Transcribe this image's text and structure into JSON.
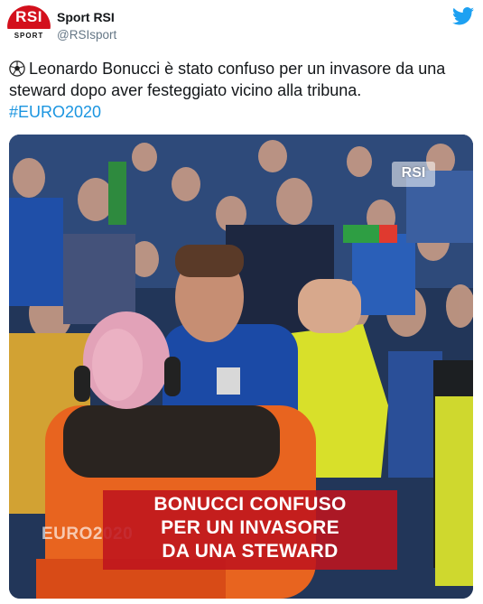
{
  "account": {
    "avatar_text": "RSI",
    "avatar_subtext": "SPORT",
    "name": "Sport RSI",
    "handle": "@RSIsport"
  },
  "tweet": {
    "emoji": "soccer-ball-icon",
    "text": "Leonardo Bonucci è stato confuso per un invasore da una steward dopo aver festeggiato vicino alla tribuna.",
    "hashtag": "#EURO2020"
  },
  "media": {
    "watermark": "RSI",
    "euro_watermark": "EURO2020",
    "caption_lines": [
      "BONUCCI CONFUSO",
      "PER UN INVASORE",
      "DA UNA STEWARD"
    ]
  },
  "colors": {
    "brand_red": "#d3101c",
    "twitter_blue": "#1da1f2",
    "hashtag": "#1b95e0",
    "text": "#14171a",
    "secondary": "#657786"
  },
  "icons": {
    "logo": "twitter-bird-icon"
  }
}
